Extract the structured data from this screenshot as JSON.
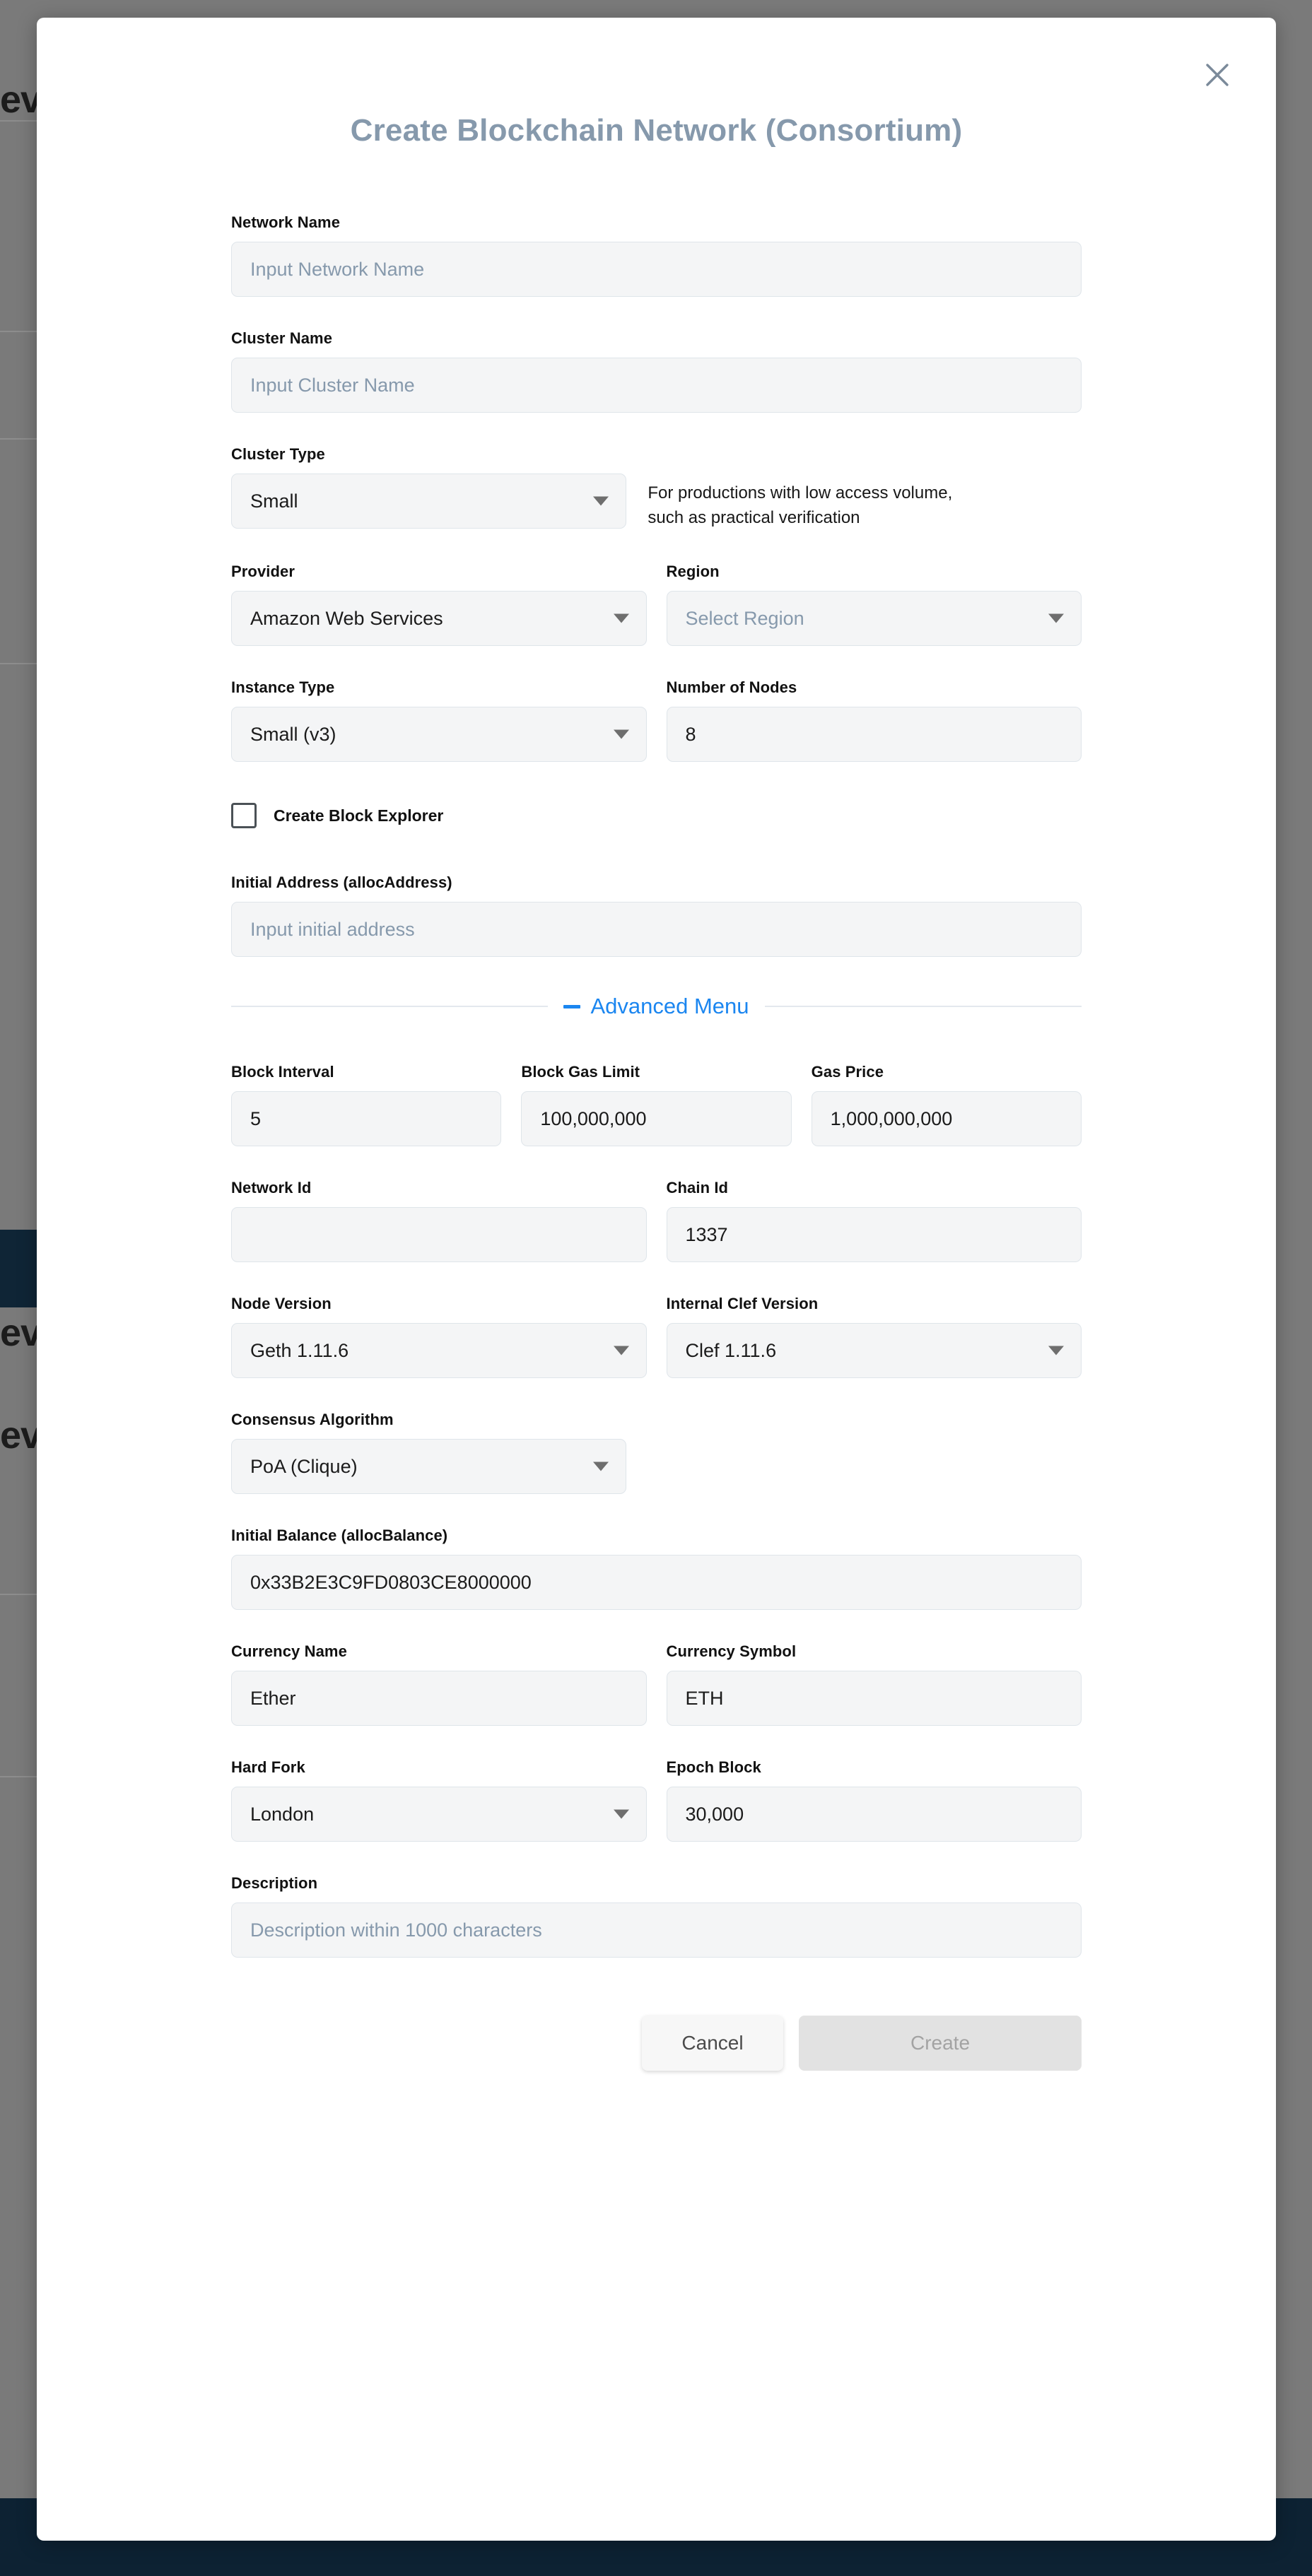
{
  "background": {
    "fragments": [
      "ev",
      "ev",
      "ev"
    ],
    "navy_color": "#0f2536",
    "overlay_color": "#7a7a7a"
  },
  "modal": {
    "title": "Create Blockchain Network (Consortium)",
    "close_icon": "close-icon",
    "fields": {
      "network_name": {
        "label": "Network Name",
        "value": "",
        "placeholder": "Input Network Name"
      },
      "cluster_name": {
        "label": "Cluster Name",
        "value": "",
        "placeholder": "Input Cluster Name"
      },
      "cluster_type": {
        "label": "Cluster Type",
        "value": "Small",
        "helper": "For productions with low access volume, such as practical verification"
      },
      "provider": {
        "label": "Provider",
        "value": "Amazon Web Services"
      },
      "region": {
        "label": "Region",
        "value": "",
        "placeholder": "Select Region"
      },
      "instance_type": {
        "label": "Instance Type",
        "value": "Small (v3)"
      },
      "number_of_nodes": {
        "label": "Number of Nodes",
        "value": "8"
      },
      "create_block_explorer": {
        "label": "Create Block Explorer",
        "checked": false
      },
      "initial_address": {
        "label": "Initial Address (allocAddress)",
        "value": "",
        "placeholder": "Input initial address"
      },
      "block_interval": {
        "label": "Block Interval",
        "value": "5"
      },
      "block_gas_limit": {
        "label": "Block Gas Limit",
        "value": "100,000,000"
      },
      "gas_price": {
        "label": "Gas Price",
        "value": "1,000,000,000"
      },
      "network_id": {
        "label": "Network Id",
        "value": ""
      },
      "chain_id": {
        "label": "Chain Id",
        "value": "1337"
      },
      "node_version": {
        "label": "Node Version",
        "value": "Geth 1.11.6"
      },
      "internal_clef_version": {
        "label": "Internal Clef Version",
        "value": "Clef 1.11.6"
      },
      "consensus_algorithm": {
        "label": "Consensus Algorithm",
        "value": "PoA (Clique)"
      },
      "initial_balance": {
        "label": "Initial Balance (allocBalance)",
        "value": "0x33B2E3C9FD0803CE8000000"
      },
      "currency_name": {
        "label": "Currency Name",
        "value": "Ether"
      },
      "currency_symbol": {
        "label": "Currency Symbol",
        "value": "ETH"
      },
      "hard_fork": {
        "label": "Hard Fork",
        "value": "London"
      },
      "epoch_block": {
        "label": "Epoch Block",
        "value": "30,000"
      },
      "description": {
        "label": "Description",
        "value": "",
        "placeholder": "Description within 1000 characters"
      }
    },
    "advanced_menu": {
      "label": "Advanced Menu",
      "icon": "minus-icon",
      "expanded": true
    },
    "buttons": {
      "cancel": "Cancel",
      "create": "Create"
    },
    "colors": {
      "title": "#8699ac",
      "accent": "#1b86f0",
      "placeholder": "#8699ac",
      "input_bg": "#f4f5f6",
      "input_border": "#dfe5ea"
    }
  }
}
